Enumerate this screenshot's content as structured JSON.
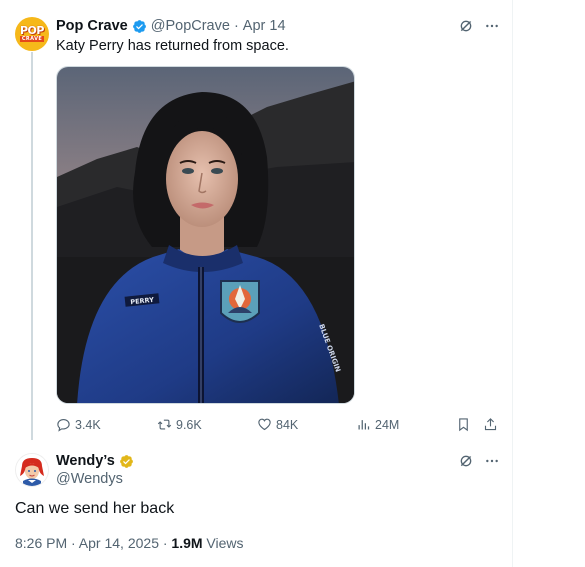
{
  "original_tweet": {
    "avatar": {
      "top_text": "POP",
      "bottom_text": "CRAVE",
      "bg_color": "#f6b81a"
    },
    "display_name": "Pop Crave",
    "handle": "@PopCrave",
    "separator": "·",
    "date": "Apr 14",
    "text": "Katy Perry has returned from space.",
    "media": {
      "patch_text": "PERRY"
    },
    "actions": {
      "replies": "3.4K",
      "reposts": "9.6K",
      "likes": "84K",
      "views": "24M"
    }
  },
  "reply_tweet": {
    "display_name": "Wendy’s",
    "handle": "@Wendys",
    "text": "Can we send her back",
    "timestamp": "8:26 PM · Apr 14, 2025 · ",
    "views_count": "1.9M",
    "views_label": " Views"
  },
  "colors": {
    "verified_blue": "#1d9bf0",
    "verified_gold": "#e2b719",
    "secondary_text": "#536471",
    "primary_text": "#0f1419"
  },
  "icons": {
    "verified": "verified-badge-icon",
    "grok": "grok-icon",
    "more": "more-icon",
    "reply": "reply-icon",
    "repost": "repost-icon",
    "like": "heart-icon",
    "views": "views-icon",
    "bookmark": "bookmark-icon",
    "share": "share-icon"
  }
}
